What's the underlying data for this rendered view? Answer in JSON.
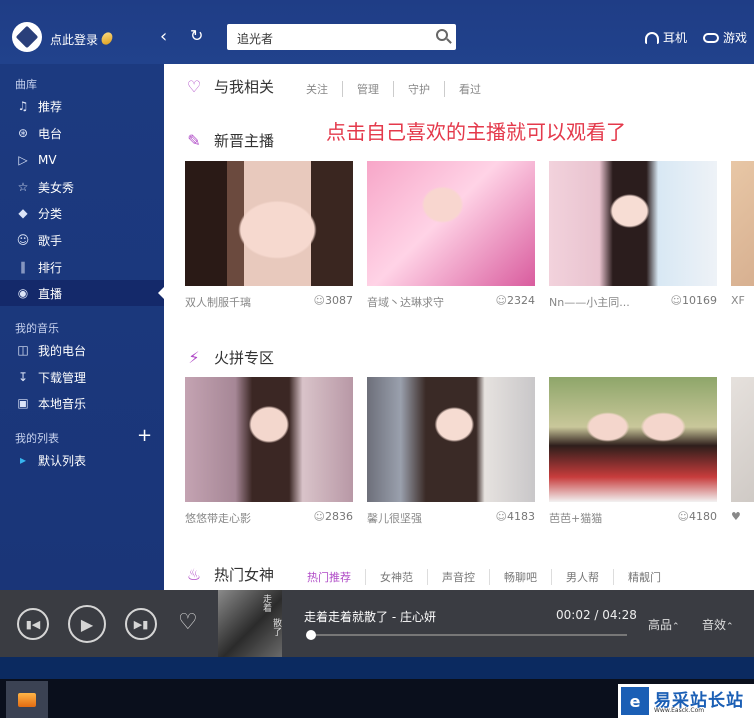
{
  "header": {
    "login_label": "点此登录",
    "search_value": "追光者",
    "earphone_label": "耳机",
    "game_label": "游戏"
  },
  "sidebar": {
    "section_library": "曲库",
    "library_items": [
      {
        "label": "推荐",
        "icon": "music-note-icon"
      },
      {
        "label": "电台",
        "icon": "radio-icon"
      },
      {
        "label": "MV",
        "icon": "mv-icon"
      },
      {
        "label": "美女秀",
        "icon": "star-icon"
      },
      {
        "label": "分类",
        "icon": "tag-icon"
      },
      {
        "label": "歌手",
        "icon": "user-icon"
      },
      {
        "label": "排行",
        "icon": "chart-bars-icon"
      },
      {
        "label": "直播",
        "icon": "microphone-icon",
        "active": true
      }
    ],
    "section_my_music": "我的音乐",
    "my_music_items": [
      {
        "label": "我的电台",
        "icon": "my-radio-icon"
      },
      {
        "label": "下载管理",
        "icon": "download-icon"
      },
      {
        "label": "本地音乐",
        "icon": "monitor-icon"
      }
    ],
    "section_my_lists": "我的列表",
    "list_items": [
      {
        "label": "默认列表",
        "icon": "speaker-icon"
      }
    ]
  },
  "main": {
    "related": {
      "title": "与我相关",
      "tabs": [
        "关注",
        "管理",
        "守护",
        "看过"
      ]
    },
    "new_anchors": {
      "title": "新晋主播",
      "promo_text": "点击自己喜欢的主播就可以观看了",
      "cards": [
        {
          "name": "双人制服千璃",
          "count": "3087"
        },
        {
          "name": "音域丶达琳求守",
          "count": "2324"
        },
        {
          "name": "Nn——小主同...",
          "count": "10169"
        },
        {
          "name": "XF",
          "count": ""
        }
      ]
    },
    "fire_zone": {
      "title": "火拼专区",
      "cards": [
        {
          "name": "悠悠带走心影",
          "count": "2836"
        },
        {
          "name": "馨儿很坚强",
          "count": "4183"
        },
        {
          "name": "芭芭+猫猫",
          "count": "4180"
        }
      ]
    },
    "hot_goddess": {
      "title": "热门女神",
      "tabs": [
        "热门推荐",
        "女神范",
        "声音控",
        "畅聊吧",
        "男人帮",
        "精靓门"
      ]
    }
  },
  "player": {
    "song_title": "走着走着就散了 - 庄心妍",
    "current_time": "00:02",
    "total_time": "/ 04:28",
    "progress": 0.01,
    "quality_label": "高品",
    "effect_label": "音效",
    "cover_text_1": "走着",
    "cover_text_2": "散了"
  },
  "watermark": {
    "title": "易采站长站",
    "subtitle": "Www.Easck.Com"
  },
  "colors": {
    "sidebar_bg": "#1c3a80",
    "accent_purple": "#b04bc7",
    "promo_red": "#e4394b",
    "player_bg": "#3a3c42"
  }
}
